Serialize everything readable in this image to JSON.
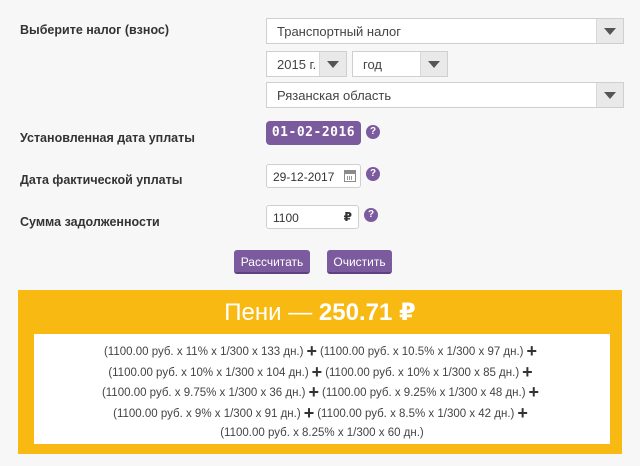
{
  "form": {
    "tax_label": "Выберите налог (взнос)",
    "tax_value": "Транспортный налог",
    "year_value": "2015 г.",
    "period_value": "год",
    "region_value": "Рязанская область",
    "due_date_label": "Установленная дата уплаты",
    "due_date_value": "01-02-2016",
    "actual_date_label": "Дата фактической уплаты",
    "actual_date_value": "29-12-2017",
    "debt_label": "Сумма задолженности",
    "debt_value": "1100",
    "currency_symbol": "₽",
    "help_glyph": "?"
  },
  "buttons": {
    "calculate": "Рассчитать",
    "clear": "Очистить"
  },
  "result": {
    "prefix": "Пени —",
    "amount": "250.71 ₽",
    "terms": [
      "(1100.00 руб. x 11% x 1/300 x 133 дн.)",
      "(1100.00 руб. x 10.5% x 1/300 x 97 дн.)",
      "(1100.00 руб. x 10% x 1/300 x 104 дн.)",
      "(1100.00 руб. x 10% x 1/300 x 85 дн.)",
      "(1100.00 руб. x 9.75% x 1/300 x 36 дн.)",
      "(1100.00 руб. x 9.25% x 1/300 x 48 дн.)",
      "(1100.00 руб. x 9% x 1/300 x 91 дн.)",
      "(1100.00 руб. x 8.5% x 1/300 x 42 дн.)",
      "(1100.00 руб. x 8.25% x 1/300 x 60 дн.)"
    ],
    "plus_glyph": "+"
  },
  "colors": {
    "accent": "#7b5a9e",
    "result_bg": "#f8b912",
    "page_bg": "#f7f7f7"
  }
}
